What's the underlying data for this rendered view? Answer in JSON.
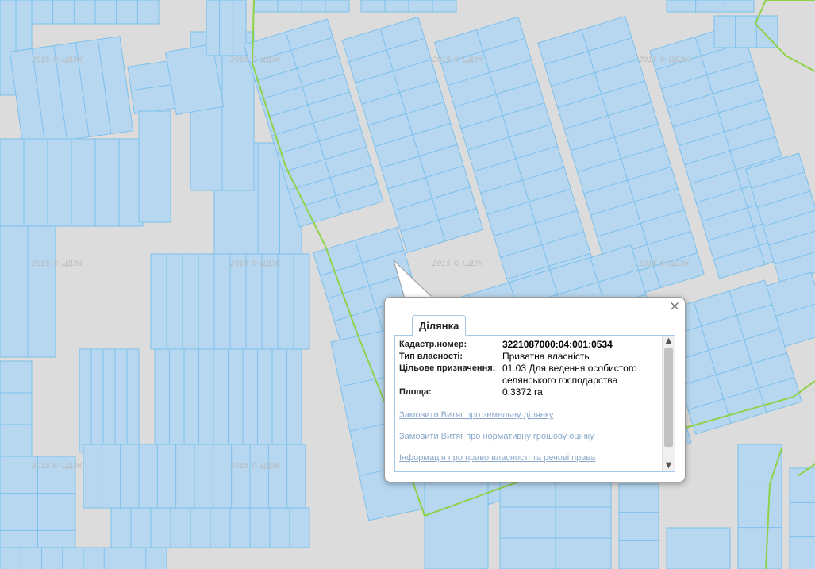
{
  "map": {
    "watermark": "2015 © ЦДЗК",
    "colors": {
      "background": "#dcdcdc",
      "parcel_fill": "#b7d7f0",
      "parcel_stroke": "#7cc0ec",
      "boundary_line": "#8ed24a"
    }
  },
  "popup": {
    "close_icon": "×",
    "tab_label": "Ділянка",
    "fields": [
      {
        "label": "Кадастр.номер:",
        "value": "3221087000:04:001:0534"
      },
      {
        "label": "Тип власності:",
        "value": "Приватна власність"
      },
      {
        "label": "Цільове призначення:",
        "value": "01.03 Для ведення особистого селянського господарства"
      },
      {
        "label": "Площа:",
        "value": "0.3372 га"
      }
    ],
    "links": [
      "Замовити Витяг про земельну ділянку",
      "Замовити Витяг про нормативну грошову оцінку",
      "Інформація про право власності та речові права"
    ],
    "scroll_up_icon": "▲",
    "scroll_down_icon": "▼"
  }
}
